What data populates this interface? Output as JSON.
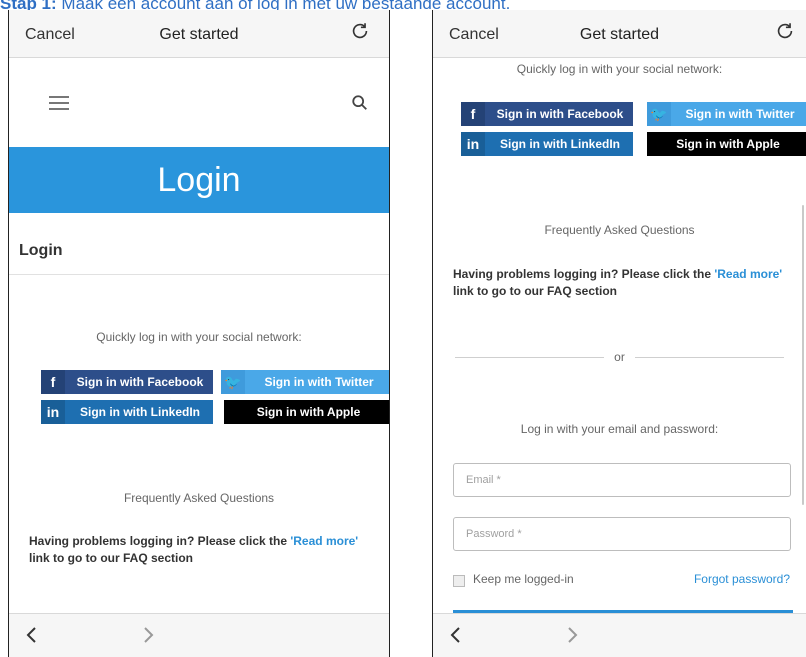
{
  "caption": {
    "prefix": "Stap 1:",
    "text": " Maak een account aan of log in met uw bestaande account."
  },
  "colors": {
    "brand_blue": "#2a95dc",
    "facebook": "#2d4e8a",
    "twitter": "#4aa8e8",
    "linkedin": "#1e6fb1",
    "apple": "#000000"
  },
  "left_phone": {
    "topbar": {
      "cancel": "Cancel",
      "title": "Get started",
      "reload_icon": "reload-icon"
    },
    "menu_icon": "hamburger-icon",
    "search_icon": "search-icon",
    "banner": "Login",
    "subheading": "Login",
    "social_prompt": "Quickly log in with your social network:",
    "social": {
      "facebook": "Sign in with Facebook",
      "twitter": "Sign in with Twitter",
      "linkedin": "Sign in with LinkedIn",
      "apple": "Sign in with Apple"
    },
    "faq_title": "Frequently Asked Questions",
    "faq_text_1": "Having problems logging in? Please click the ",
    "faq_link": "'Read more'",
    "faq_text_2": " link to go to our FAQ section"
  },
  "right_phone": {
    "topbar": {
      "cancel": "Cancel",
      "title": "Get started"
    },
    "social_prompt": "Quickly log in with your social network:",
    "social": {
      "facebook": "Sign in with Facebook",
      "twitter": "Sign in with Twitter",
      "linkedin": "Sign in with LinkedIn",
      "apple": "Sign in with Apple"
    },
    "faq_title": "Frequently Asked Questions",
    "faq_text_1": "Having problems logging in? Please click the ",
    "faq_link": "'Read more'",
    "faq_text_2": " link to go to our FAQ section",
    "or_text": "or",
    "email_prompt": "Log in with your email and password:",
    "email_placeholder": "Email *",
    "password_placeholder": "Password *",
    "keep_logged_in": "Keep me logged-in",
    "forgot_password": "Forgot password?"
  }
}
